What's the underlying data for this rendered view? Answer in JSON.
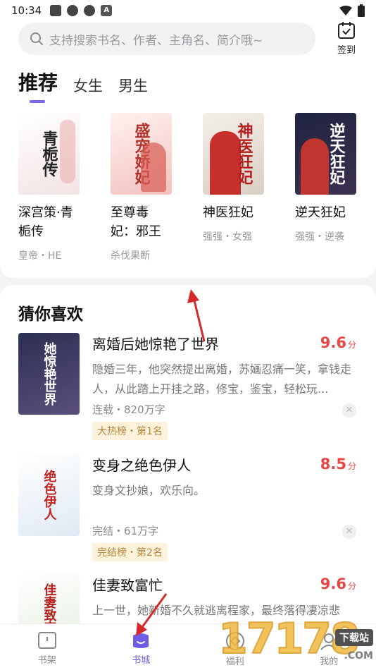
{
  "status": {
    "time": "10:34"
  },
  "search": {
    "placeholder": "支持搜索书名、作者、主角名、简介哦~"
  },
  "checkin": {
    "label": "签到"
  },
  "tabs": [
    {
      "label": "推荐",
      "active": true
    },
    {
      "label": "女生",
      "active": false
    },
    {
      "label": "男生",
      "active": false
    }
  ],
  "recommend": [
    {
      "title": "深宫策·青栀传",
      "tags": "皇帝・HE",
      "cover_text": "青栀传",
      "cover_color": "#f7ecec"
    },
    {
      "title": "至尊毒妃：邪王",
      "tags": "杀伐果断",
      "cover_text": "盛宠娇妃",
      "cover_color": "#f9dede"
    },
    {
      "title": "神医狂妃",
      "tags": "强强・女强",
      "cover_text": "神医狂妃",
      "cover_color": "#e8e2dc"
    },
    {
      "title": "逆天狂妃",
      "tags": "强强・逆袭",
      "cover_text": "逆天狂妃",
      "cover_color": "#2a2f4a"
    }
  ],
  "guess": {
    "title": "猜你喜欢",
    "books": [
      {
        "title": "离婚后她惊艳了世界",
        "score": "9.6",
        "score_unit": "分",
        "desc": "隐婚三年，他突然提出离婚，苏婳忍痛一笑，拿钱走人，从此踏上开挂之路，修宝，鉴宝，轻松玩...",
        "meta": "连载・820万字",
        "badge": "大热榜・第1名",
        "cover_text": "她惊艳世界",
        "cover_color": "#3b3f63"
      },
      {
        "title": "变身之绝色伊人",
        "score": "8.5",
        "score_unit": "分",
        "desc": "变身文抄娘，欢乐向。",
        "meta": "完结・61万字",
        "badge": "完结榜・第2名",
        "cover_text": "绝色伊人",
        "cover_color": "#eef3f8"
      },
      {
        "title": "佳妻致富忙",
        "score": "9.6",
        "score_unit": "分",
        "desc": "上一世，她新婚不久就逃离程家，最终落得凄凉悲",
        "meta": "",
        "badge": "",
        "cover_text": "佳妻致富忙",
        "cover_color": "#eaf2e6"
      }
    ]
  },
  "nav": [
    {
      "label": "书架",
      "icon": "bookshelf-icon",
      "active": false
    },
    {
      "label": "书城",
      "icon": "bookstore-icon",
      "active": true
    },
    {
      "label": "福利",
      "icon": "welfare-icon",
      "active": false
    },
    {
      "label": "我的",
      "icon": "profile-icon",
      "active": false
    }
  ],
  "watermark": {
    "digits": "17178",
    "brand": "下载站",
    "domain": ".COM"
  },
  "colors": {
    "accent": "#7b68ee",
    "score": "#e84545",
    "badge_bg": "#fdf2dc",
    "badge_text": "#b8863b",
    "arrow": "#d62a2a"
  }
}
